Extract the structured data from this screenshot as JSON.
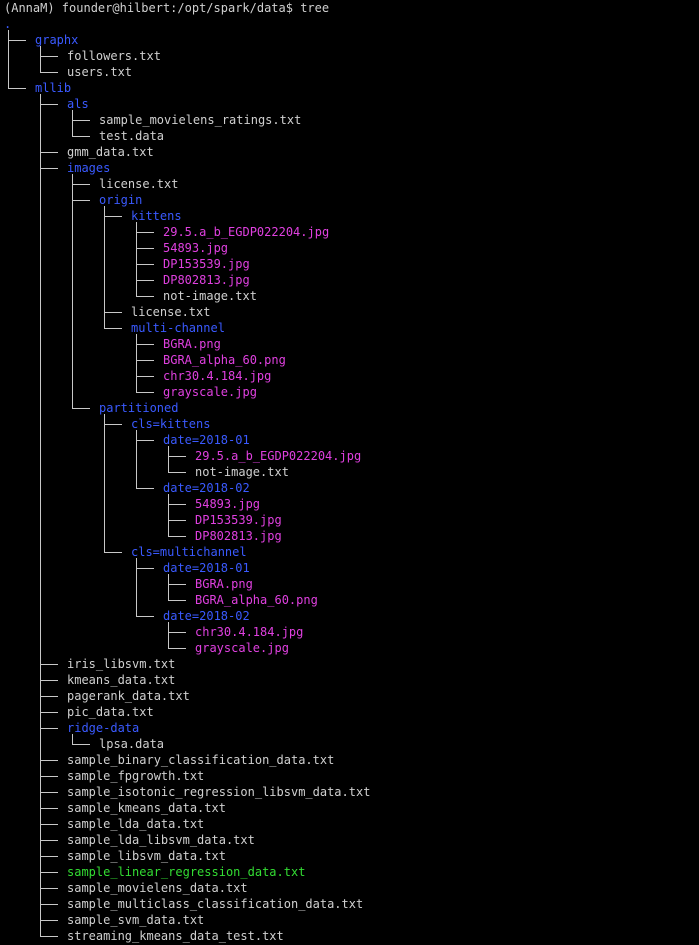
{
  "terminal": {
    "prompt": "(AnnaM) founder@hilbert:/opt/spark/data$ tree",
    "root": ".",
    "colors": {
      "dir": "#3a5aff",
      "file": "#d0d0d0",
      "image": "#e040e0",
      "exec": "#33dd33",
      "tree": "#c8c8c8"
    },
    "entries": [
      {
        "depth": 0,
        "name": "graphx",
        "type": "dir",
        "last": false
      },
      {
        "depth": 1,
        "name": "followers.txt",
        "type": "file",
        "last": false
      },
      {
        "depth": 1,
        "name": "users.txt",
        "type": "file",
        "last": true
      },
      {
        "depth": 0,
        "name": "mllib",
        "type": "dir",
        "last": true
      },
      {
        "depth": 1,
        "name": "als",
        "type": "dir",
        "last": false
      },
      {
        "depth": 2,
        "name": "sample_movielens_ratings.txt",
        "type": "file",
        "last": false
      },
      {
        "depth": 2,
        "name": "test.data",
        "type": "file",
        "last": true
      },
      {
        "depth": 1,
        "name": "gmm_data.txt",
        "type": "file",
        "last": false
      },
      {
        "depth": 1,
        "name": "images",
        "type": "dir",
        "last": false
      },
      {
        "depth": 2,
        "name": "license.txt",
        "type": "file",
        "last": false
      },
      {
        "depth": 2,
        "name": "origin",
        "type": "dir",
        "last": false
      },
      {
        "depth": 3,
        "name": "kittens",
        "type": "dir",
        "last": false
      },
      {
        "depth": 4,
        "name": "29.5.a_b_EGDP022204.jpg",
        "type": "image",
        "last": false
      },
      {
        "depth": 4,
        "name": "54893.jpg",
        "type": "image",
        "last": false
      },
      {
        "depth": 4,
        "name": "DP153539.jpg",
        "type": "image",
        "last": false
      },
      {
        "depth": 4,
        "name": "DP802813.jpg",
        "type": "image",
        "last": false
      },
      {
        "depth": 4,
        "name": "not-image.txt",
        "type": "file",
        "last": true
      },
      {
        "depth": 3,
        "name": "license.txt",
        "type": "file",
        "last": false
      },
      {
        "depth": 3,
        "name": "multi-channel",
        "type": "dir",
        "last": true
      },
      {
        "depth": 4,
        "name": "BGRA.png",
        "type": "image",
        "last": false
      },
      {
        "depth": 4,
        "name": "BGRA_alpha_60.png",
        "type": "image",
        "last": false
      },
      {
        "depth": 4,
        "name": "chr30.4.184.jpg",
        "type": "image",
        "last": false
      },
      {
        "depth": 4,
        "name": "grayscale.jpg",
        "type": "image",
        "last": true
      },
      {
        "depth": 2,
        "name": "partitioned",
        "type": "dir",
        "last": true
      },
      {
        "depth": 3,
        "name": "cls=kittens",
        "type": "dir",
        "last": false
      },
      {
        "depth": 4,
        "name": "date=2018-01",
        "type": "dir",
        "last": false
      },
      {
        "depth": 5,
        "name": "29.5.a_b_EGDP022204.jpg",
        "type": "image",
        "last": false
      },
      {
        "depth": 5,
        "name": "not-image.txt",
        "type": "file",
        "last": true
      },
      {
        "depth": 4,
        "name": "date=2018-02",
        "type": "dir",
        "last": true
      },
      {
        "depth": 5,
        "name": "54893.jpg",
        "type": "image",
        "last": false
      },
      {
        "depth": 5,
        "name": "DP153539.jpg",
        "type": "image",
        "last": false
      },
      {
        "depth": 5,
        "name": "DP802813.jpg",
        "type": "image",
        "last": true
      },
      {
        "depth": 3,
        "name": "cls=multichannel",
        "type": "dir",
        "last": true
      },
      {
        "depth": 4,
        "name": "date=2018-01",
        "type": "dir",
        "last": false
      },
      {
        "depth": 5,
        "name": "BGRA.png",
        "type": "image",
        "last": false
      },
      {
        "depth": 5,
        "name": "BGRA_alpha_60.png",
        "type": "image",
        "last": true
      },
      {
        "depth": 4,
        "name": "date=2018-02",
        "type": "dir",
        "last": true
      },
      {
        "depth": 5,
        "name": "chr30.4.184.jpg",
        "type": "image",
        "last": false
      },
      {
        "depth": 5,
        "name": "grayscale.jpg",
        "type": "image",
        "last": true
      },
      {
        "depth": 1,
        "name": "iris_libsvm.txt",
        "type": "file",
        "last": false
      },
      {
        "depth": 1,
        "name": "kmeans_data.txt",
        "type": "file",
        "last": false
      },
      {
        "depth": 1,
        "name": "pagerank_data.txt",
        "type": "file",
        "last": false
      },
      {
        "depth": 1,
        "name": "pic_data.txt",
        "type": "file",
        "last": false
      },
      {
        "depth": 1,
        "name": "ridge-data",
        "type": "dir",
        "last": false
      },
      {
        "depth": 2,
        "name": "lpsa.data",
        "type": "file",
        "last": true
      },
      {
        "depth": 1,
        "name": "sample_binary_classification_data.txt",
        "type": "file",
        "last": false
      },
      {
        "depth": 1,
        "name": "sample_fpgrowth.txt",
        "type": "file",
        "last": false
      },
      {
        "depth": 1,
        "name": "sample_isotonic_regression_libsvm_data.txt",
        "type": "file",
        "last": false
      },
      {
        "depth": 1,
        "name": "sample_kmeans_data.txt",
        "type": "file",
        "last": false
      },
      {
        "depth": 1,
        "name": "sample_lda_data.txt",
        "type": "file",
        "last": false
      },
      {
        "depth": 1,
        "name": "sample_lda_libsvm_data.txt",
        "type": "file",
        "last": false
      },
      {
        "depth": 1,
        "name": "sample_libsvm_data.txt",
        "type": "file",
        "last": false
      },
      {
        "depth": 1,
        "name": "sample_linear_regression_data.txt",
        "type": "exec",
        "last": false
      },
      {
        "depth": 1,
        "name": "sample_movielens_data.txt",
        "type": "file",
        "last": false
      },
      {
        "depth": 1,
        "name": "sample_multiclass_classification_data.txt",
        "type": "file",
        "last": false
      },
      {
        "depth": 1,
        "name": "sample_svm_data.txt",
        "type": "file",
        "last": false
      },
      {
        "depth": 1,
        "name": "streaming_kmeans_data_test.txt",
        "type": "file",
        "last": true
      }
    ]
  }
}
